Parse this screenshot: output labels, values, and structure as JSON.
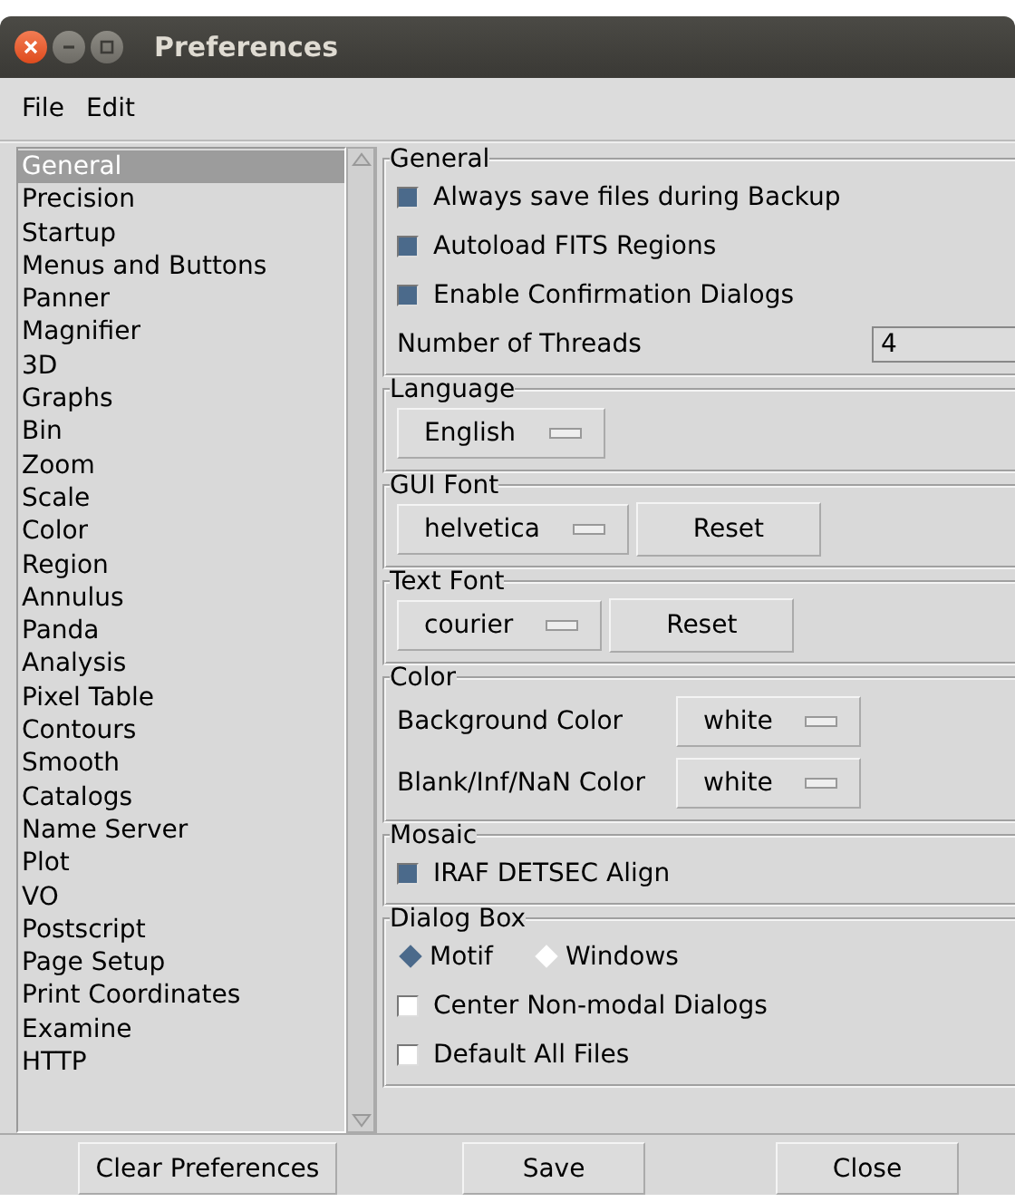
{
  "window": {
    "title": "Preferences"
  },
  "menu": [
    "File",
    "Edit"
  ],
  "sidebar": {
    "items": [
      {
        "label": "General",
        "selected": true
      },
      {
        "label": "Precision",
        "selected": false
      },
      {
        "label": "Startup",
        "selected": false
      },
      {
        "label": "Menus and Buttons",
        "selected": false
      },
      {
        "label": "Panner",
        "selected": false
      },
      {
        "label": "Magnifier",
        "selected": false
      },
      {
        "label": "3D",
        "selected": false
      },
      {
        "label": "Graphs",
        "selected": false
      },
      {
        "label": "Bin",
        "selected": false
      },
      {
        "label": "Zoom",
        "selected": false
      },
      {
        "label": "Scale",
        "selected": false
      },
      {
        "label": "Color",
        "selected": false
      },
      {
        "label": "Region",
        "selected": false
      },
      {
        "label": "Annulus",
        "selected": false
      },
      {
        "label": "Panda",
        "selected": false
      },
      {
        "label": "Analysis",
        "selected": false
      },
      {
        "label": "Pixel Table",
        "selected": false
      },
      {
        "label": "Contours",
        "selected": false
      },
      {
        "label": "Smooth",
        "selected": false
      },
      {
        "label": "Catalogs",
        "selected": false
      },
      {
        "label": "Name Server",
        "selected": false
      },
      {
        "label": "Plot",
        "selected": false
      },
      {
        "label": "VO",
        "selected": false
      },
      {
        "label": "Postscript",
        "selected": false
      },
      {
        "label": "Page Setup",
        "selected": false
      },
      {
        "label": "Print Coordinates",
        "selected": false
      },
      {
        "label": "Examine",
        "selected": false
      },
      {
        "label": "HTTP",
        "selected": false
      }
    ]
  },
  "sections": [
    {
      "title": "General",
      "items": [
        {
          "kind": "checkbox",
          "label": "Always save files during Backup",
          "checked": true
        },
        {
          "kind": "checkbox",
          "label": "Autoload FITS Regions",
          "checked": true
        },
        {
          "kind": "checkbox",
          "label": "Enable Confirmation Dialogs",
          "checked": true
        },
        {
          "kind": "entry",
          "label": "Number of Threads",
          "value": "4"
        }
      ]
    },
    {
      "title": "Language",
      "items": [
        {
          "kind": "menubutton",
          "value": "English"
        }
      ]
    },
    {
      "title": "GUI Font",
      "items": [
        {
          "kind": "menubutton",
          "value": "helvetica",
          "button": "Reset"
        }
      ]
    },
    {
      "title": "Text Font",
      "items": [
        {
          "kind": "menubutton",
          "value": "courier",
          "button": "Reset"
        }
      ]
    },
    {
      "title": "Color",
      "items": [
        {
          "kind": "labeled_menu",
          "label": "Background Color",
          "value": "white"
        },
        {
          "kind": "labeled_menu",
          "label": "Blank/Inf/NaN Color",
          "value": "white"
        }
      ]
    },
    {
      "title": "Mosaic",
      "items": [
        {
          "kind": "checkbox",
          "label": "IRAF DETSEC Align",
          "checked": true
        }
      ]
    },
    {
      "title": "Dialog Box",
      "items": [
        {
          "kind": "radio",
          "options": [
            {
              "label": "Motif",
              "selected": true
            },
            {
              "label": "Windows",
              "selected": false
            }
          ]
        },
        {
          "kind": "checkbox",
          "label": "Center Non-modal Dialogs",
          "checked": false
        },
        {
          "kind": "checkbox",
          "label": "Default All Files",
          "checked": false
        }
      ]
    }
  ],
  "buttons": [
    "Clear Preferences",
    "Save",
    "Close"
  ]
}
